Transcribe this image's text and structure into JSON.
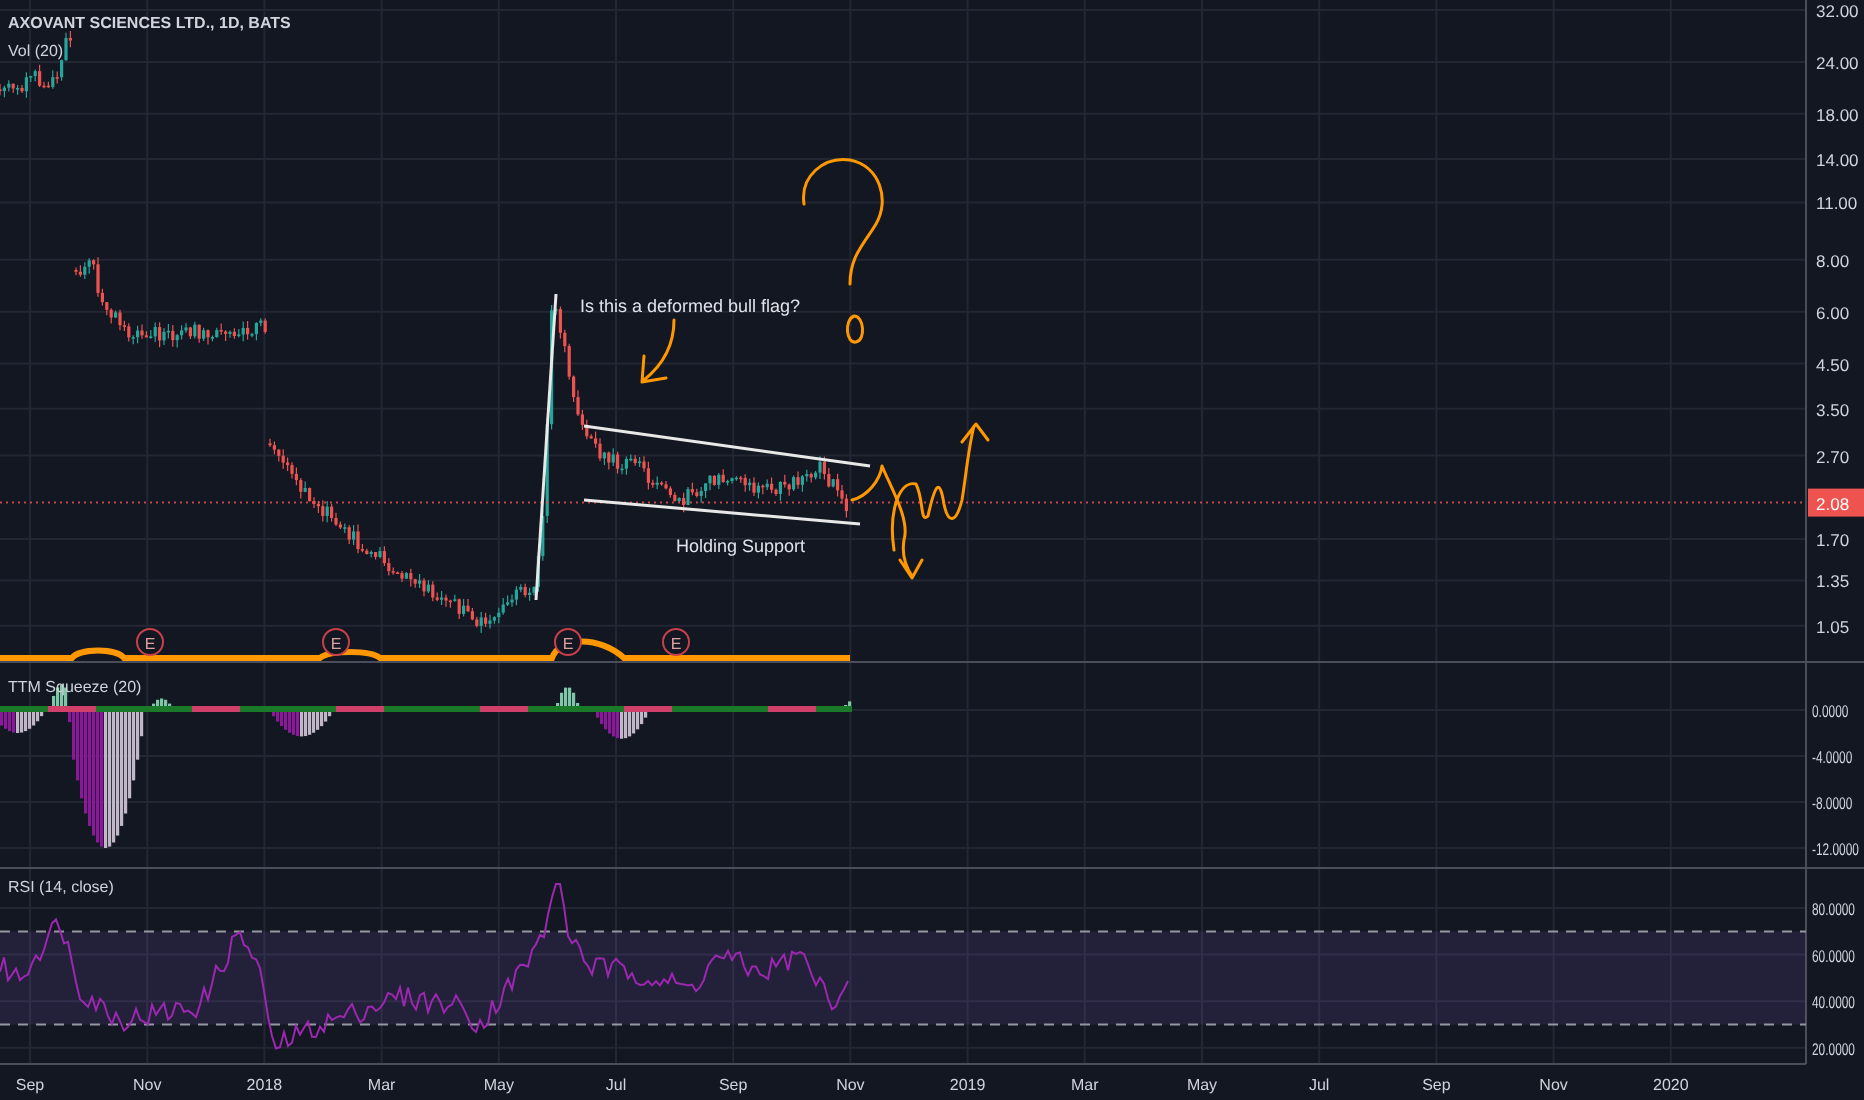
{
  "legend": {
    "symbol": "AXOVANT SCIENCES LTD., 1D, BATS",
    "volume": "Vol (20)"
  },
  "price_axis": {
    "ticks": [
      "32.00",
      "24.00",
      "18.00",
      "14.00",
      "11.00",
      "8.00",
      "6.00",
      "4.50",
      "3.50",
      "2.70",
      "1.70",
      "1.35",
      "1.05"
    ],
    "last_price": "2.08"
  },
  "annotations": [
    "Is this a deformed bull flag?",
    "Holding Support"
  ],
  "earnings_markers": [
    "E",
    "E",
    "E",
    "E"
  ],
  "squeeze_pane": {
    "title": "TTM Squeeze (20)",
    "ticks": [
      "0.0000",
      "-4.0000",
      "-8.0000",
      "-12.0000"
    ]
  },
  "rsi_pane": {
    "title": "RSI (14, close)",
    "ticks": [
      "80.0000",
      "60.0000",
      "40.0000",
      "20.0000"
    ]
  },
  "time_axis": [
    "Sep",
    "Nov",
    "2018",
    "Mar",
    "May",
    "Jul",
    "Sep",
    "Nov",
    "2019",
    "Mar",
    "May",
    "Jul",
    "Sep",
    "Nov",
    "2020"
  ]
}
